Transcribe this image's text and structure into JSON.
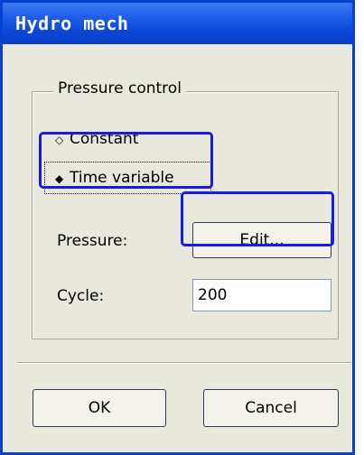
{
  "window": {
    "title": "Hydro mech"
  },
  "pressure_control": {
    "legend": "Pressure control",
    "options": [
      {
        "label": "Constant",
        "selected": false
      },
      {
        "label": "Time variable",
        "selected": true
      }
    ],
    "pressure_label": "Pressure:",
    "edit_button": "Edit...",
    "cycle_label": "Cycle:",
    "cycle_value": "200"
  },
  "buttons": {
    "ok": "OK",
    "cancel": "Cancel"
  },
  "annotation_color": "#1a1ae0"
}
